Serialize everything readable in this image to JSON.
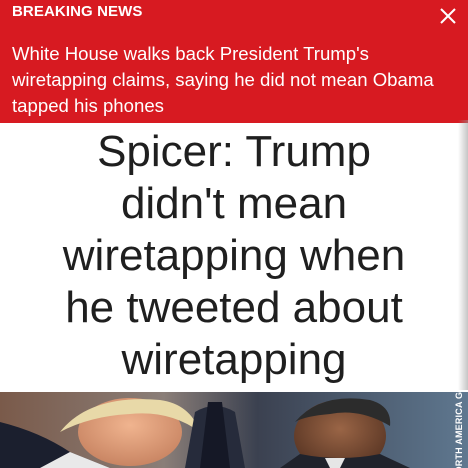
{
  "banner": {
    "label": "BREAKING NEWS",
    "close_icon": "close-icon",
    "text": "White House walks back President Trump's wiretapping claims, saying he did not mean Obama tapped his phones",
    "background_color": "#d71a21"
  },
  "headline": {
    "lines": [
      "Spicer: Trump",
      "didn't mean",
      "wiretapping when",
      "he tweeted about",
      "wiretapping"
    ]
  },
  "photo": {
    "watermark": "NORTH AMERICA GET"
  }
}
